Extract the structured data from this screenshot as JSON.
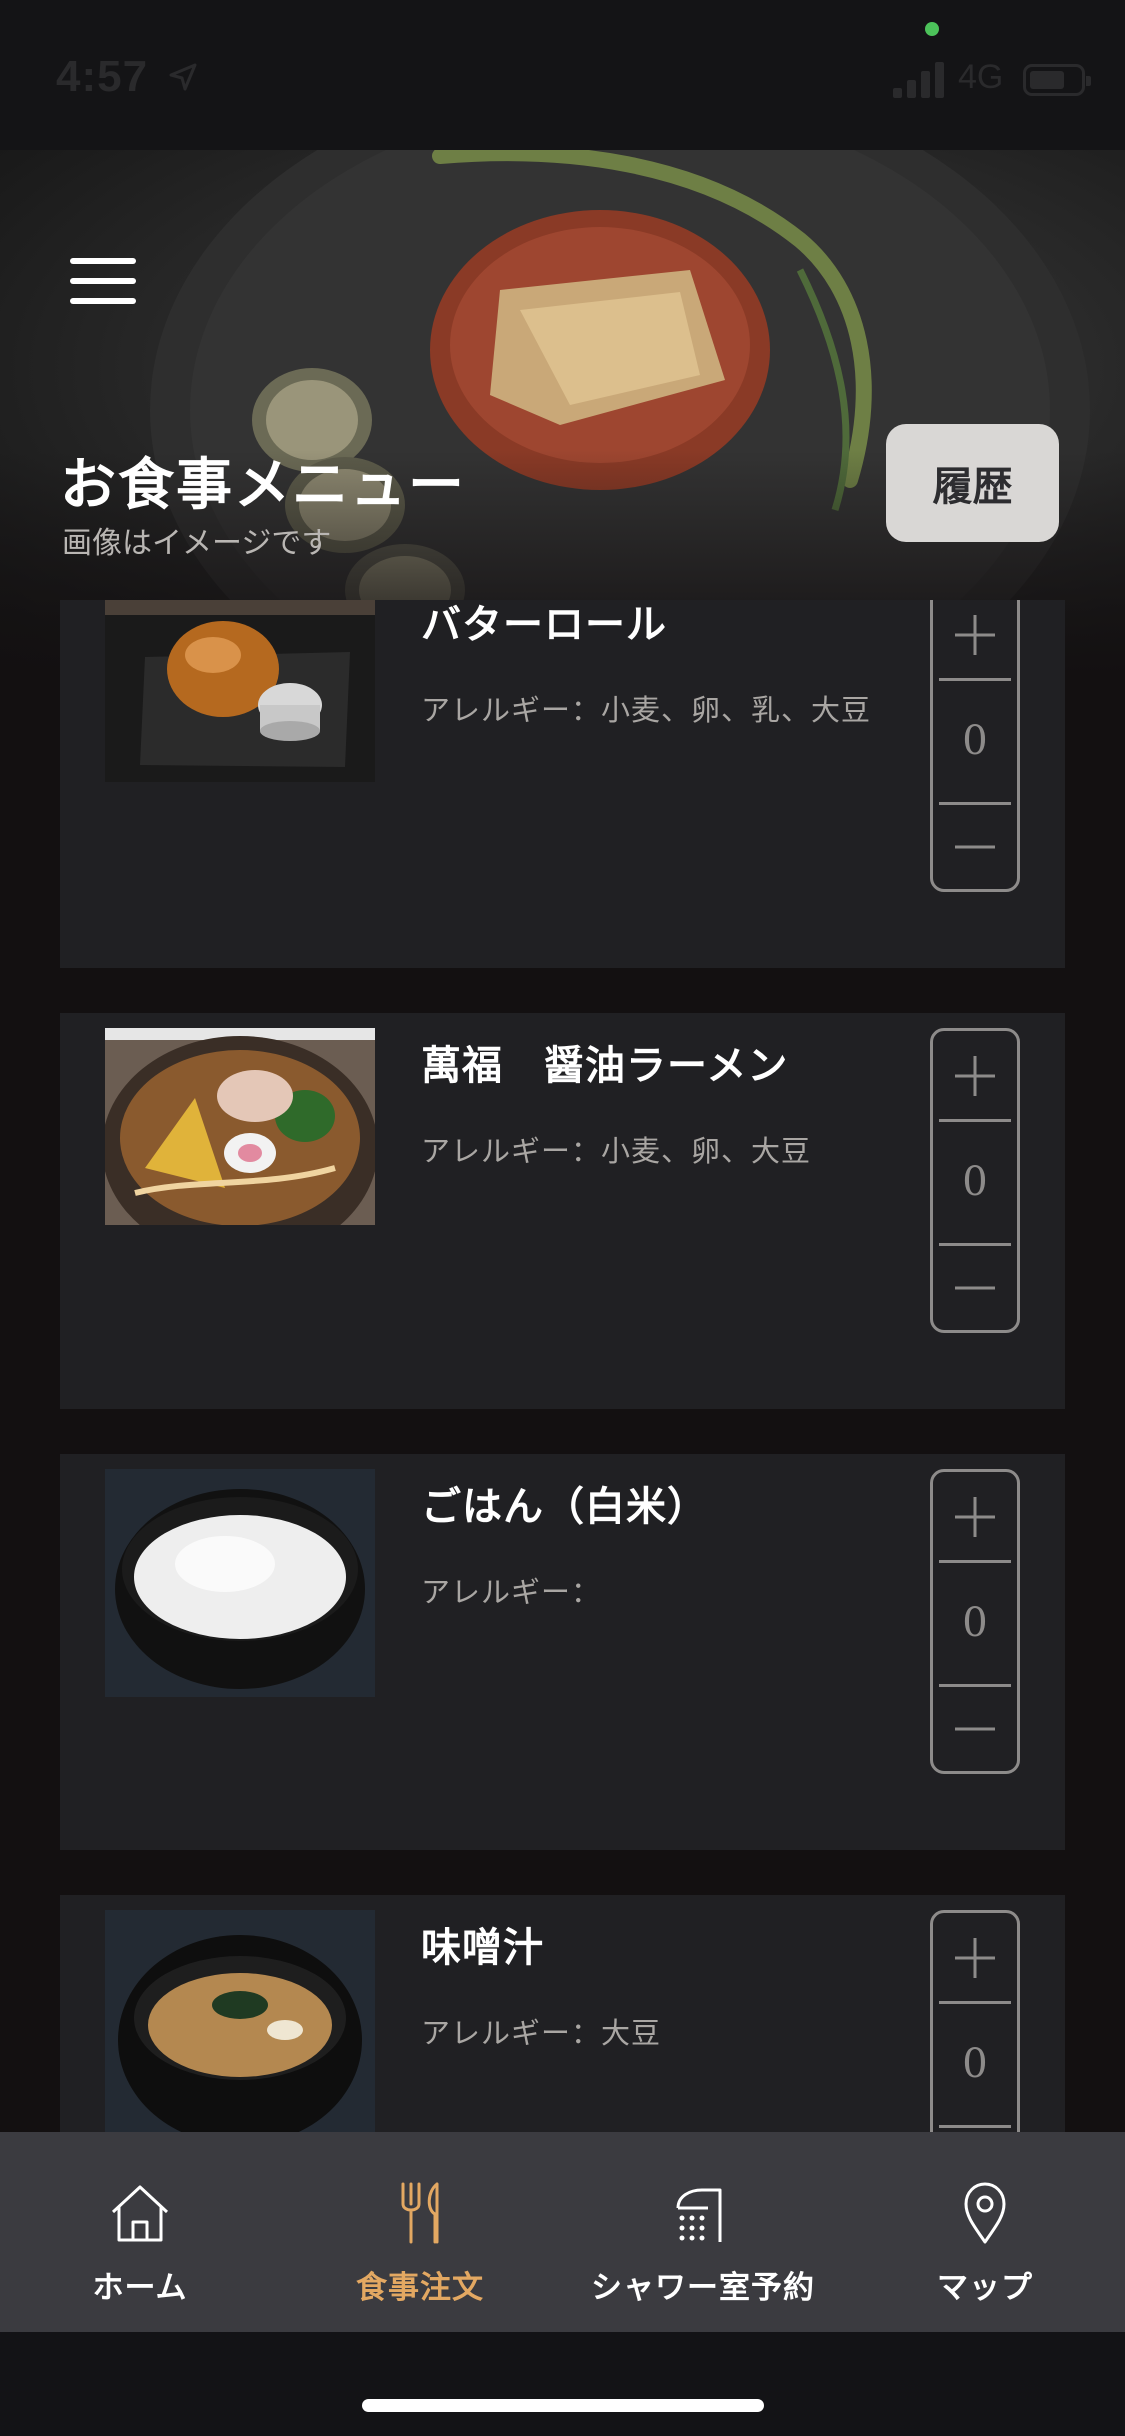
{
  "status_bar": {
    "time": "4:57",
    "network": "4G"
  },
  "header": {
    "title": "お食事メニュー",
    "subtitle": "画像はイメージです",
    "history_button": "履歴"
  },
  "menu_items": [
    {
      "name": "バターロール",
      "allergy": "アレルギー：小麦、卵、乳、大豆",
      "quantity": "0"
    },
    {
      "name": "萬福　醤油ラーメン",
      "allergy": "アレルギー：小麦、卵、大豆",
      "quantity": "0"
    },
    {
      "name": "ごはん（白米）",
      "allergy": "アレルギー：",
      "quantity": "0"
    },
    {
      "name": "味噌汁",
      "allergy": "アレルギー：大豆",
      "quantity": "0"
    }
  ],
  "tab_bar": {
    "items": [
      {
        "label": "ホーム",
        "icon": "home-icon"
      },
      {
        "label": "食事注文",
        "icon": "fork-knife-icon",
        "active": true
      },
      {
        "label": "シャワー室予約",
        "icon": "shower-icon"
      },
      {
        "label": "マップ",
        "icon": "map-pin-icon"
      }
    ]
  },
  "colors": {
    "accent": "#e3a862",
    "card": "#202023",
    "background": "#131011",
    "tab_bar": "#3b3b40"
  }
}
